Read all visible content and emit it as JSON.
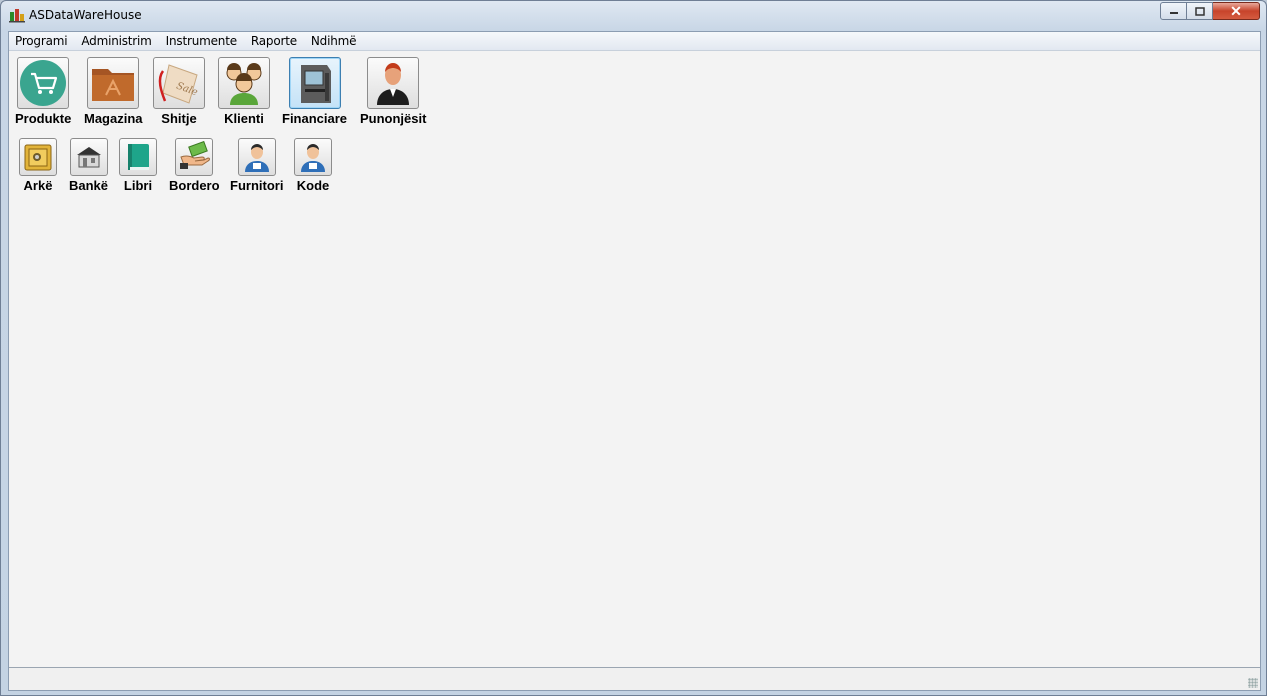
{
  "window": {
    "title": "ASDataWareHouse"
  },
  "caption": {
    "min": "▭",
    "max": "❐",
    "close": "✕"
  },
  "menu": [
    "Programi",
    "Administrim",
    "Instrumente",
    "Raporte",
    "Ndihmë"
  ],
  "tiles_row1": [
    {
      "label": "Produkte",
      "icon": "shopping-cart-icon"
    },
    {
      "label": "Magazina",
      "icon": "folder-icon"
    },
    {
      "label": "Shitje",
      "icon": "sale-tag-icon",
      "tag_text": "Sale"
    },
    {
      "label": "Klienti",
      "icon": "clients-icon"
    },
    {
      "label": "Financiare",
      "icon": "atm-icon",
      "selected": true
    },
    {
      "label": "Punonjësit",
      "icon": "employee-icon"
    }
  ],
  "tiles_row2": [
    {
      "label": "Arkë",
      "icon": "safe-icon"
    },
    {
      "label": "Bankë",
      "icon": "bank-icon"
    },
    {
      "label": "Libri",
      "icon": "book-icon"
    },
    {
      "label": "Bordero",
      "icon": "money-hand-icon"
    },
    {
      "label": "Furnitori",
      "icon": "supplier-icon"
    },
    {
      "label": "Kode",
      "icon": "person-code-icon"
    }
  ]
}
